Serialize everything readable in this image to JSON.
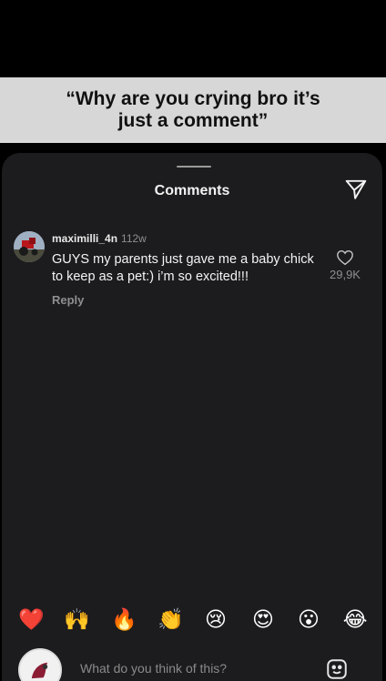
{
  "caption": {
    "text": "“Why are you crying bro it’s just a comment”"
  },
  "comments_sheet": {
    "title": "Comments",
    "icons": {
      "share": "paper-plane-icon",
      "like": "heart-icon",
      "sticker": "sticker-icon"
    },
    "comments": [
      {
        "username": "maximilli_4n",
        "timestamp": "112w",
        "text": "GUYS my parents just gave me a baby chick to keep as a pet:) i’m so excited!!!",
        "likes": "29,9K",
        "reply_label": "Reply"
      }
    ],
    "quick_reactions": [
      "❤️",
      "🙌",
      "🔥",
      "👏",
      "😢",
      "😍",
      "😮",
      "😂"
    ],
    "composer": {
      "placeholder": "What do you think of this?",
      "value": ""
    }
  }
}
